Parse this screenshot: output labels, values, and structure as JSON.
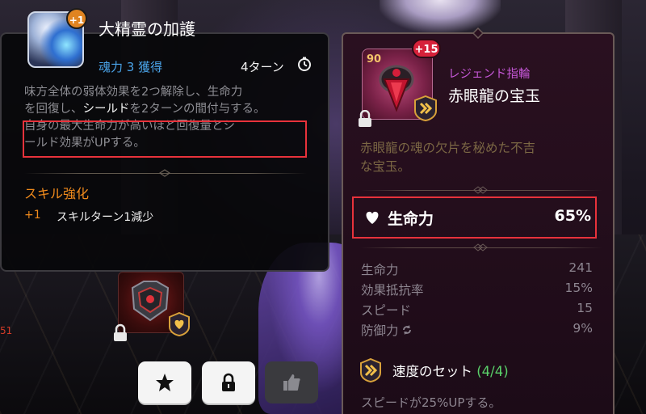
{
  "skill": {
    "plus_badge": "+1",
    "name": "大精霊の加護",
    "soul_gain": "魂力 3 獲得",
    "cooldown": "4ターン",
    "desc_line1": "味方全体の弱体効果を2つ解除し、生命力",
    "desc_line2a": "を回復し、",
    "desc_line2b": "シールド",
    "desc_line2c": "を2ターンの間付与する。",
    "desc_line3": "自身の最大生命力が高いほど回復量とシ",
    "desc_line4": "ールド効果がUPする。",
    "enhance_title": "スキル強化",
    "enhance_level": "+1",
    "enhance_text": "スキルターン1減少"
  },
  "side_number": "51",
  "equipment": {
    "level": "90",
    "enhance": "+15",
    "type": "レジェンド指輪",
    "name": "赤眼龍の宝玉",
    "description_line1": "赤眼龍の魂の欠片を秘めた不吉",
    "description_line2": "な宝玉。",
    "main_stat": {
      "label": "生命力",
      "value": "65%"
    },
    "sub_stats": [
      {
        "label": "生命力",
        "value": "241"
      },
      {
        "label": "効果抵抗率",
        "value": "15%"
      },
      {
        "label": "スピード",
        "value": "15"
      },
      {
        "label": "防御力",
        "value": "9%"
      }
    ],
    "set_name": "速度のセット",
    "set_count": "(4/4)",
    "set_desc": "スピードが25%UPする。"
  },
  "colors": {
    "highlight": "#e8323b",
    "skill_gain": "#4aa3e8",
    "enhance": "#ef8a1c",
    "legend": "#c457d6",
    "set_count": "#5ad26a"
  },
  "icons": [
    "clock-icon",
    "heart-icon",
    "lock-icon",
    "star-icon",
    "thumbs-up-icon",
    "speed-set-icon",
    "heart-set-icon",
    "reforge-icon"
  ]
}
